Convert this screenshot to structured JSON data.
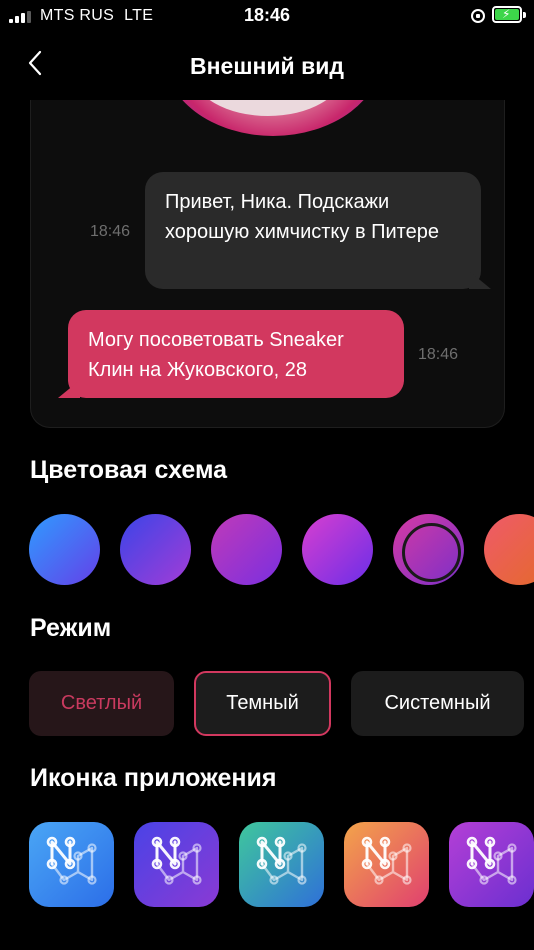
{
  "status_bar": {
    "carrier": "MTS RUS",
    "network": "LTE",
    "time": "18:46"
  },
  "nav": {
    "title": "Внешний вид"
  },
  "preview": {
    "incoming": {
      "text": "Привет, Ника. Подскажи хорошую химчистку в Питере",
      "time": "18:46"
    },
    "outgoing": {
      "text": "Могу посоветовать Sneaker Клин на Жуковского, 28",
      "time": "18:46"
    }
  },
  "color_scheme": {
    "title": "Цветовая схема",
    "options": [
      {
        "name": "blue",
        "from": "#2f9bff",
        "to": "#6440e8"
      },
      {
        "name": "indigo",
        "from": "#3a45e8",
        "to": "#a33cd6"
      },
      {
        "name": "violet-pink",
        "from": "#c03ab8",
        "to": "#7a2fe0"
      },
      {
        "name": "purple",
        "from": "#d83fcf",
        "to": "#6b2ee8"
      },
      {
        "name": "magenta",
        "from": "#d53aa3",
        "to": "#7b2fc9",
        "selected": true
      },
      {
        "name": "coral",
        "from": "#ef5a6a",
        "to": "#e46a2a"
      }
    ]
  },
  "mode": {
    "title": "Режим",
    "options": [
      {
        "label": "Светлый",
        "selected": false
      },
      {
        "label": "Темный",
        "selected": true
      },
      {
        "label": "Системный",
        "selected": false
      }
    ]
  },
  "app_icon": {
    "title": "Иконка приложения",
    "options": [
      {
        "name": "sky",
        "from": "#4aa6f5",
        "to": "#2c6ee8"
      },
      {
        "name": "blue-violet",
        "from": "#4a43e6",
        "to": "#8a3ad4"
      },
      {
        "name": "teal",
        "from": "#3fc79c",
        "to": "#2f70d8"
      },
      {
        "name": "sunset",
        "from": "#f3a44a",
        "to": "#e0406f"
      },
      {
        "name": "purple",
        "from": "#b43fd6",
        "to": "#6b2fd0"
      }
    ]
  },
  "colors": {
    "accent": "#d2385f",
    "background": "#000000",
    "card": "#1c1c1c"
  }
}
